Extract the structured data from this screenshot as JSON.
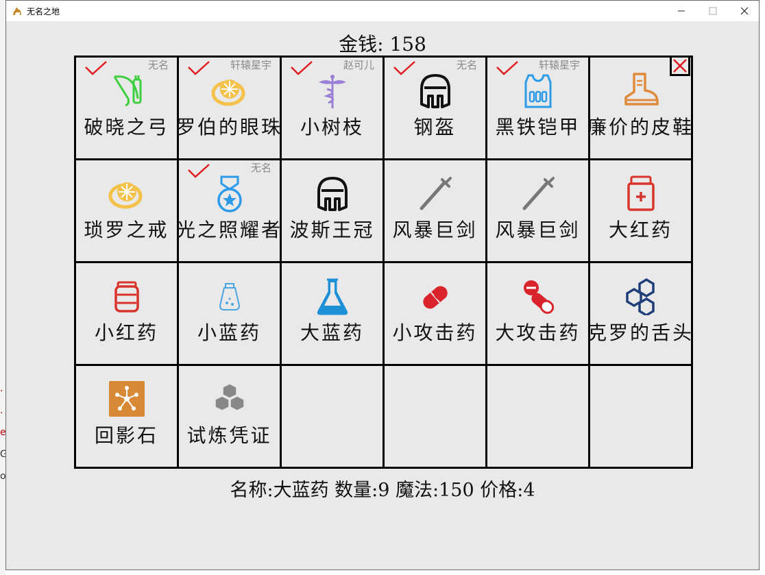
{
  "window": {
    "title": "无名之地"
  },
  "header": {
    "gold_label": "金钱: 158"
  },
  "inventory": [
    {
      "name": "破晓之弓",
      "icon": "bow-icon",
      "checked": true,
      "owner": "无名"
    },
    {
      "name": "罗伯的眼珠",
      "icon": "ring-icon",
      "checked": true,
      "owner": "轩辕星宇"
    },
    {
      "name": "小树枝",
      "icon": "caduceus-icon",
      "checked": true,
      "owner": "赵可儿"
    },
    {
      "name": "钢盔",
      "icon": "helmet-icon",
      "checked": true,
      "owner": "无名"
    },
    {
      "name": "黑铁铠甲",
      "icon": "vest-icon",
      "checked": true,
      "owner": "轩辕星宇"
    },
    {
      "name": "廉价的皮鞋",
      "icon": "boot-icon",
      "checked": false,
      "owner": ""
    },
    {
      "name": "琐罗之戒",
      "icon": "ring-icon",
      "checked": false,
      "owner": ""
    },
    {
      "name": "光之照耀者",
      "icon": "medal-icon",
      "checked": true,
      "owner": "无名"
    },
    {
      "name": "波斯王冠",
      "icon": "helmet-icon",
      "checked": false,
      "owner": ""
    },
    {
      "name": "风暴巨剑",
      "icon": "sword-icon",
      "checked": false,
      "owner": ""
    },
    {
      "name": "风暴巨剑",
      "icon": "sword-icon",
      "checked": false,
      "owner": ""
    },
    {
      "name": "大红药",
      "icon": "medkit-icon",
      "checked": false,
      "owner": ""
    },
    {
      "name": "小红药",
      "icon": "jar-icon",
      "checked": false,
      "owner": ""
    },
    {
      "name": "小蓝药",
      "icon": "potion-bottle-icon",
      "checked": false,
      "owner": ""
    },
    {
      "name": "大蓝药",
      "icon": "flask-icon",
      "checked": false,
      "owner": ""
    },
    {
      "name": "小攻击药",
      "icon": "capsule-icon",
      "checked": false,
      "owner": ""
    },
    {
      "name": "大攻击药",
      "icon": "pills-icon",
      "checked": false,
      "owner": ""
    },
    {
      "name": "克罗的舌头",
      "icon": "hexagons-icon",
      "checked": false,
      "owner": ""
    },
    {
      "name": "回影石",
      "icon": "network-stone-icon",
      "checked": false,
      "owner": ""
    },
    {
      "name": "试炼凭证",
      "icon": "cubes-icon",
      "checked": false,
      "owner": ""
    },
    {
      "name": "",
      "icon": "",
      "checked": false,
      "owner": ""
    },
    {
      "name": "",
      "icon": "",
      "checked": false,
      "owner": ""
    },
    {
      "name": "",
      "icon": "",
      "checked": false,
      "owner": ""
    },
    {
      "name": "",
      "icon": "",
      "checked": false,
      "owner": ""
    }
  ],
  "footer": {
    "info": "名称:大蓝药 数量:9 魔法:150 价格:4"
  },
  "colors": {
    "check": "#e11b22",
    "background": "#e9e9e9",
    "grid": "#000000"
  }
}
